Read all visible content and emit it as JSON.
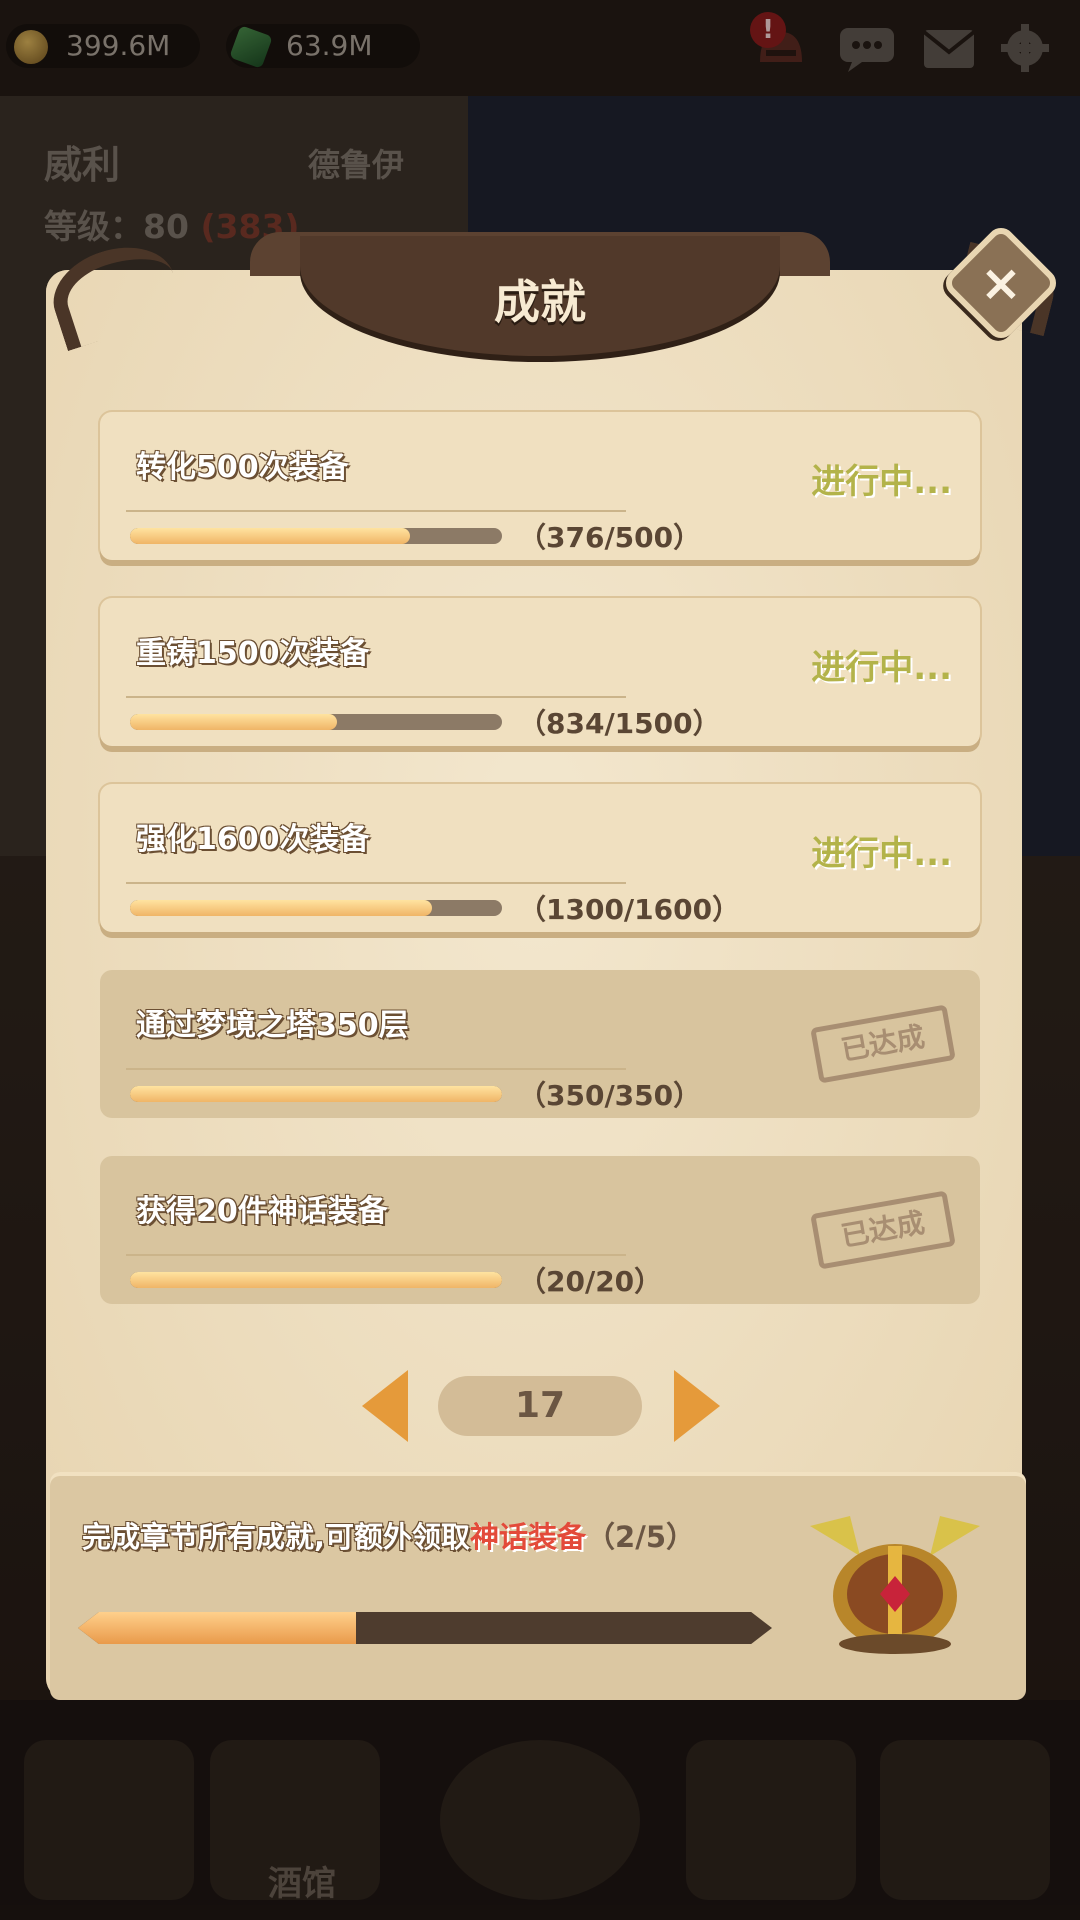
{
  "resources": [
    {
      "name": "gold",
      "value": "399.6M"
    },
    {
      "name": "gem",
      "value": "63.9M"
    }
  ],
  "hero": {
    "name": "威利",
    "class": "德鲁伊",
    "level_label": "等级：80",
    "level_extra": "(383)"
  },
  "modal": {
    "title": "成就",
    "close_label": "×"
  },
  "achievements": [
    {
      "title": "转化500次装备",
      "count": "（376/500）",
      "progress": 0.752,
      "status": "进行中..."
    },
    {
      "title": "重铸1500次装备",
      "count": "（834/1500）",
      "progress": 0.556,
      "status": "进行中..."
    },
    {
      "title": "强化1600次装备",
      "count": "（1300/1600）",
      "progress": 0.8125,
      "status": "进行中..."
    },
    {
      "title": "通过梦境之塔350层",
      "count": "（350/350）",
      "progress": 1.0,
      "status": "已达成"
    },
    {
      "title": "获得20件神话装备",
      "count": "（20/20）",
      "progress": 1.0,
      "status": "已达成"
    }
  ],
  "pager": {
    "page": "17"
  },
  "chapter": {
    "text": "完成章节所有成就,可额外领取",
    "reward": "神话装备",
    "count": "（2/5）",
    "progress": 0.4
  },
  "nav": {
    "tavern_label": "酒馆"
  },
  "colors": {
    "parchment": "#ecdcbd",
    "status_in_progress": "#b3b34a",
    "progress_fill": "#f0b567",
    "highlight_red": "#e34a3a"
  }
}
